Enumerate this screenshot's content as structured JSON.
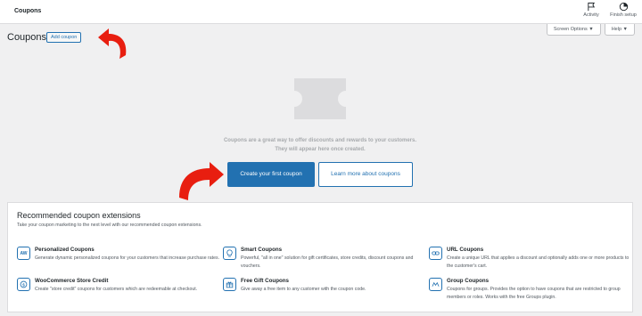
{
  "header": {
    "title": "Coupons",
    "activity_label": "Activity",
    "finish_setup_label": "Finish setup"
  },
  "screen_options_label": "Screen Options ▼",
  "help_label": "Help ▼",
  "page": {
    "title": "Coupons",
    "add_coupon_label": "Add coupon"
  },
  "empty_state": {
    "message": "Coupons are a great way to offer discounts and rewards to your customers. They will appear here once created.",
    "primary_button": "Create your first coupon",
    "secondary_button": "Learn more about coupons"
  },
  "recommended": {
    "title": "Recommended coupon extensions",
    "subtitle": "Take your coupon marketing to the next level with our recommended coupon extensions.",
    "items": [
      {
        "icon_text": "AW",
        "icon": "aw-logo-icon",
        "name": "Personalized Coupons",
        "desc": "Generate dynamic personalized coupons for your customers that increase purchase rates."
      },
      {
        "icon_text": "",
        "icon": "lightbulb-icon",
        "name": "Smart Coupons",
        "desc": "Powerful, \"all in one\" solution for gift certificates, store credits, discount coupons and vouchers."
      },
      {
        "icon_text": "",
        "icon": "link-icon",
        "name": "URL Coupons",
        "desc": "Create a unique URL that applies a discount and optionally adds one or more products to the customer's cart."
      },
      {
        "icon_text": "",
        "icon": "currency-icon",
        "name": "WooCommerce Store Credit",
        "desc": "Create \"store credit\" coupons for customers which are redeemable at checkout."
      },
      {
        "icon_text": "",
        "icon": "gift-icon",
        "name": "Free Gift Coupons",
        "desc": "Give away a free item to any customer with the coupon code."
      },
      {
        "icon_text": "",
        "icon": "group-icon",
        "name": "Group Coupons",
        "desc": "Coupons for groups. Provides the option to have coupons that are restricted to group members or roles. Works with the free Groups plugin."
      }
    ]
  },
  "colors": {
    "accent": "#2271b1",
    "arrow": "#e81e10",
    "background": "#f0f0f1"
  }
}
